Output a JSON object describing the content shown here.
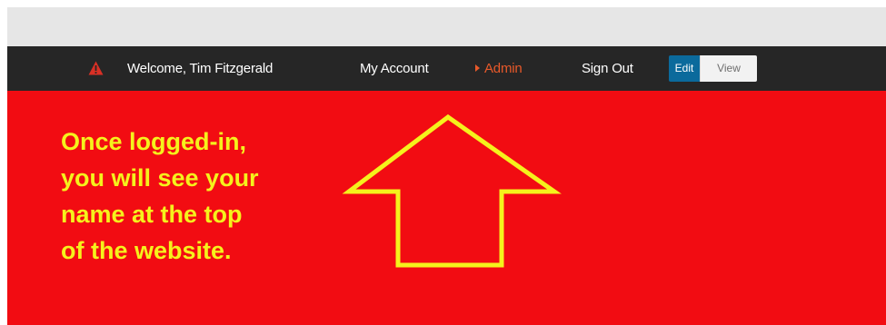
{
  "navbar": {
    "welcome_text": "Welcome, Tim Fitzgerald",
    "my_account_label": "My Account",
    "admin_label": "Admin",
    "sign_out_label": "Sign Out",
    "edit_label": "Edit",
    "view_label": "View"
  },
  "hero": {
    "callout_lines": [
      "Once logged-in,",
      "you will see your",
      "name at the top",
      "of the website."
    ]
  },
  "colors": {
    "navbar_bg": "#262626",
    "accent_admin": "#e8592a",
    "edit_active": "#0b6a9c",
    "hero_bg": "#f20c12",
    "callout_yellow": "#f5f21c",
    "warning_icon": "#d93025"
  },
  "icons": {
    "warning": "warning-triangle-icon",
    "admin_caret": "caret-right-icon",
    "pointer": "up-arrow-outline"
  }
}
